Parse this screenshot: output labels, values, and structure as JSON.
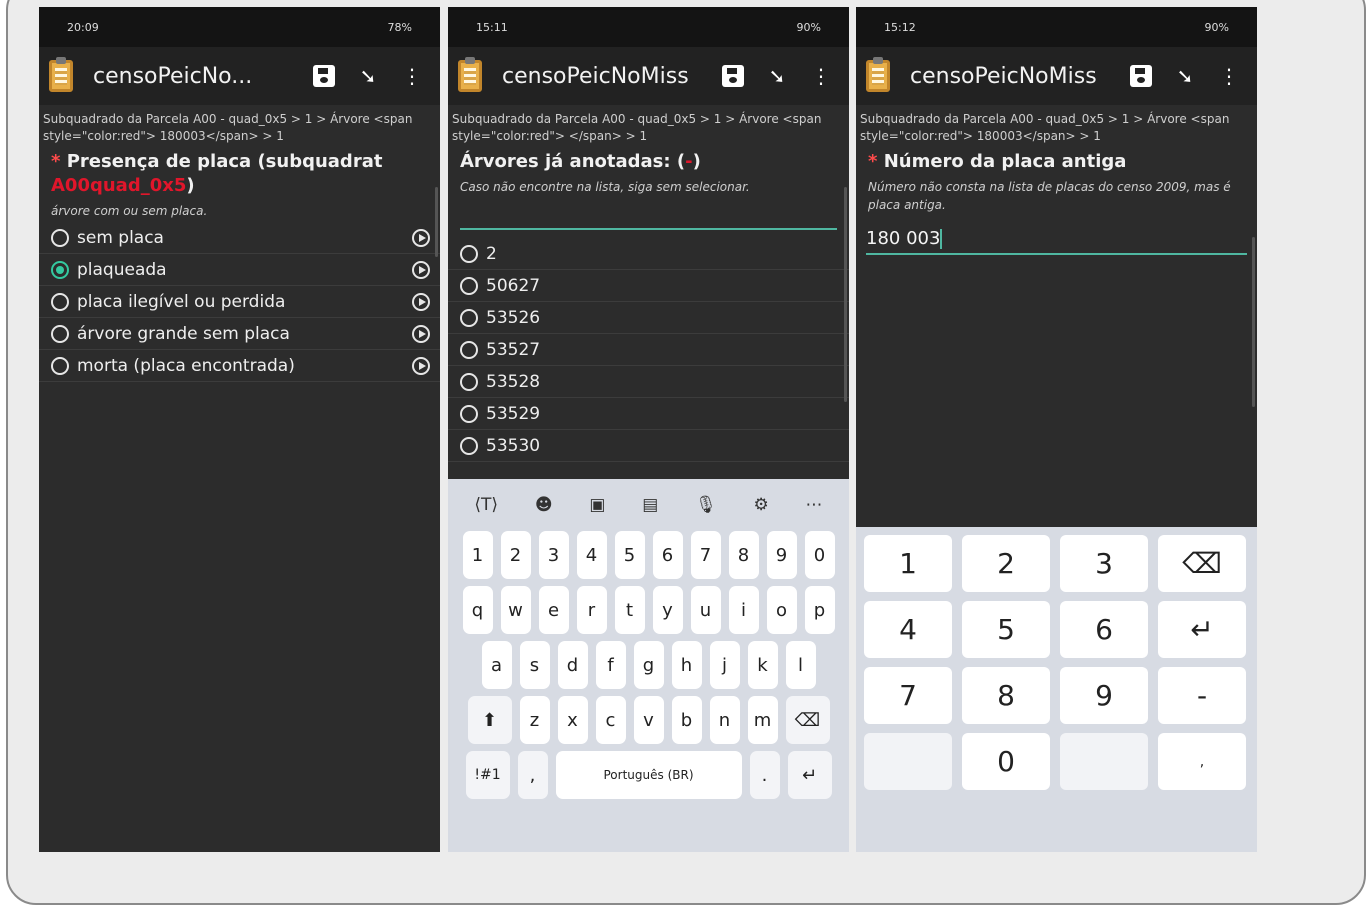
{
  "colors": {
    "accent": "#4fb7a1",
    "required": "#ff4b4b",
    "highlight": "#e0162b"
  },
  "phones": [
    {
      "status": {
        "time": "20:09",
        "right": "78%"
      },
      "app_title": "censoPeicNo...",
      "breadcrumb": "Subquadrado da Parcela A00 - quad_0x5 > 1 > Árvore <span style=\"color:red\"> 180003</span> > 1",
      "question": "Presença de placa (subquadrat",
      "question_highlight": "A00quad_0x5",
      "question_end": ")",
      "hint": "árvore com ou sem placa.",
      "options": [
        "sem placa",
        "plaqueada",
        "placa ilegível ou perdida",
        "árvore grande sem placa",
        "morta (placa encontrada)"
      ],
      "selected_option": "plaqueada"
    },
    {
      "status": {
        "time": "15:11",
        "right": "90%"
      },
      "app_title": "censoPeicNoMiss",
      "breadcrumb": "Subquadrado da Parcela A00 - quad_0x5 > 1 > Árvore <span style=\"color:red\"> </span> > 1",
      "question": "Árvores já anotadas: (",
      "question_highlight": "-",
      "question_end": ")",
      "hint": "Caso não encontre na lista, siga sem selecionar.",
      "options": [
        "2",
        "50627",
        "53526",
        "53527",
        "53528",
        "53529",
        "53530"
      ],
      "keyboard": {
        "row1": [
          "1",
          "2",
          "3",
          "4",
          "5",
          "6",
          "7",
          "8",
          "9",
          "0"
        ],
        "row2": [
          "q",
          "w",
          "e",
          "r",
          "t",
          "y",
          "u",
          "i",
          "o",
          "p"
        ],
        "row3": [
          "a",
          "s",
          "d",
          "f",
          "g",
          "h",
          "j",
          "k",
          "l"
        ],
        "row4": [
          "z",
          "x",
          "c",
          "v",
          "b",
          "n",
          "m"
        ],
        "symbols": "!#1",
        "comma": ",",
        "space": "Português (BR)",
        "period": "."
      }
    },
    {
      "status": {
        "time": "15:12",
        "right": "90%"
      },
      "app_title": "censoPeicNoMiss",
      "breadcrumb": "Subquadrado da Parcela A00 - quad_0x5 > 1 > Árvore <span style=\"color:red\"> 180003</span> > 1",
      "question": "Número da placa antiga",
      "hint": "Número não consta na lista de placas do censo 2009, mas é placa antiga.",
      "input_value": "180 003",
      "numpad": [
        "1",
        "2",
        "3",
        "⌫",
        "4",
        "5",
        "6",
        "↵",
        "7",
        "8",
        "9",
        "-",
        "",
        "0",
        "",
        ","
      ]
    }
  ]
}
